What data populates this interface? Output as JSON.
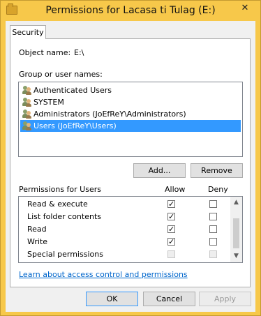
{
  "window": {
    "title": "Permissions for Lacasa ti Tulag (E:)",
    "close_glyph": "✕"
  },
  "tabs": [
    {
      "label": "Security"
    }
  ],
  "object": {
    "label": "Object name:",
    "value": "E:\\"
  },
  "group": {
    "label": "Group or user names:",
    "users": [
      {
        "name": "Authenticated Users",
        "selected": false
      },
      {
        "name": "SYSTEM",
        "selected": false
      },
      {
        "name": "Administrators (JoEfReY\\Administrators)",
        "selected": false
      },
      {
        "name": "Users (JoEfReY\\Users)",
        "selected": true
      }
    ]
  },
  "buttons": {
    "add": "Add...",
    "remove": "Remove",
    "ok": "OK",
    "cancel": "Cancel",
    "apply": "Apply"
  },
  "permissions": {
    "header": "Permissions for Users",
    "allow_label": "Allow",
    "deny_label": "Deny",
    "rows": [
      {
        "name": "Read & execute",
        "allow": true,
        "deny": false,
        "disabled": false
      },
      {
        "name": "List folder contents",
        "allow": true,
        "deny": false,
        "disabled": false
      },
      {
        "name": "Read",
        "allow": true,
        "deny": false,
        "disabled": false
      },
      {
        "name": "Write",
        "allow": true,
        "deny": false,
        "disabled": false
      },
      {
        "name": "Special permissions",
        "allow": false,
        "deny": false,
        "disabled": true
      }
    ]
  },
  "link": {
    "text": "Learn about access control and permissions"
  },
  "colors": {
    "selection": "#3399ff",
    "link": "#0066cc",
    "frame": "#f7c84a"
  },
  "icons": {
    "user_group": "users-icon",
    "check": "✓",
    "scroll_up": "▲",
    "scroll_down": "▼"
  }
}
